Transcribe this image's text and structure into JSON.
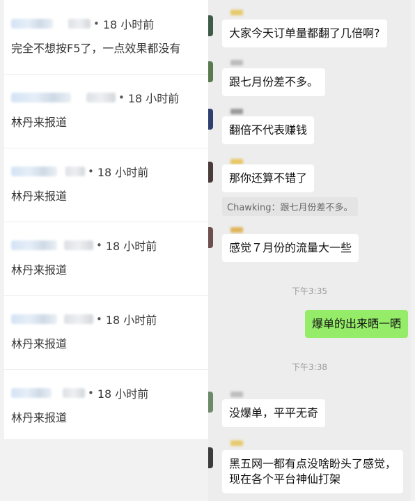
{
  "comments": [
    {
      "time": "18 小时前",
      "dot": "•",
      "text": "完全不想按F5了，一点效果都没有"
    },
    {
      "time": "18 小时前",
      "dot": "•",
      "text": "林丹来报道"
    },
    {
      "time": "18 小时前",
      "dot": "•",
      "text": "林丹来报道"
    },
    {
      "time": "18 小时前",
      "dot": "•",
      "text": "林丹来报道"
    },
    {
      "time": "18 小时前",
      "dot": "•",
      "text": "林丹来报道"
    },
    {
      "time": "18 小时前",
      "dot": "•",
      "text": "林丹来报道"
    }
  ],
  "chat": {
    "messages": [
      {
        "text": "大家今天订单量都翻了几倍啊?"
      },
      {
        "text": "跟七月份差不多。"
      },
      {
        "text": "翻倍不代表赚钱"
      },
      {
        "text": "那你还算不错了"
      },
      {
        "text": "感觉７月份的流量大一些"
      },
      {
        "text": "爆单的出来晒一晒"
      },
      {
        "text": "没爆单，平平无奇"
      },
      {
        "text": "黑五网一都有点没啥盼头了感觉，"
      },
      {
        "text": "现在各个平台神仙打架"
      }
    ],
    "quote": "Chawking：跟七月份差不多。",
    "timestamps": [
      "下午3:35",
      "下午3:38"
    ]
  }
}
